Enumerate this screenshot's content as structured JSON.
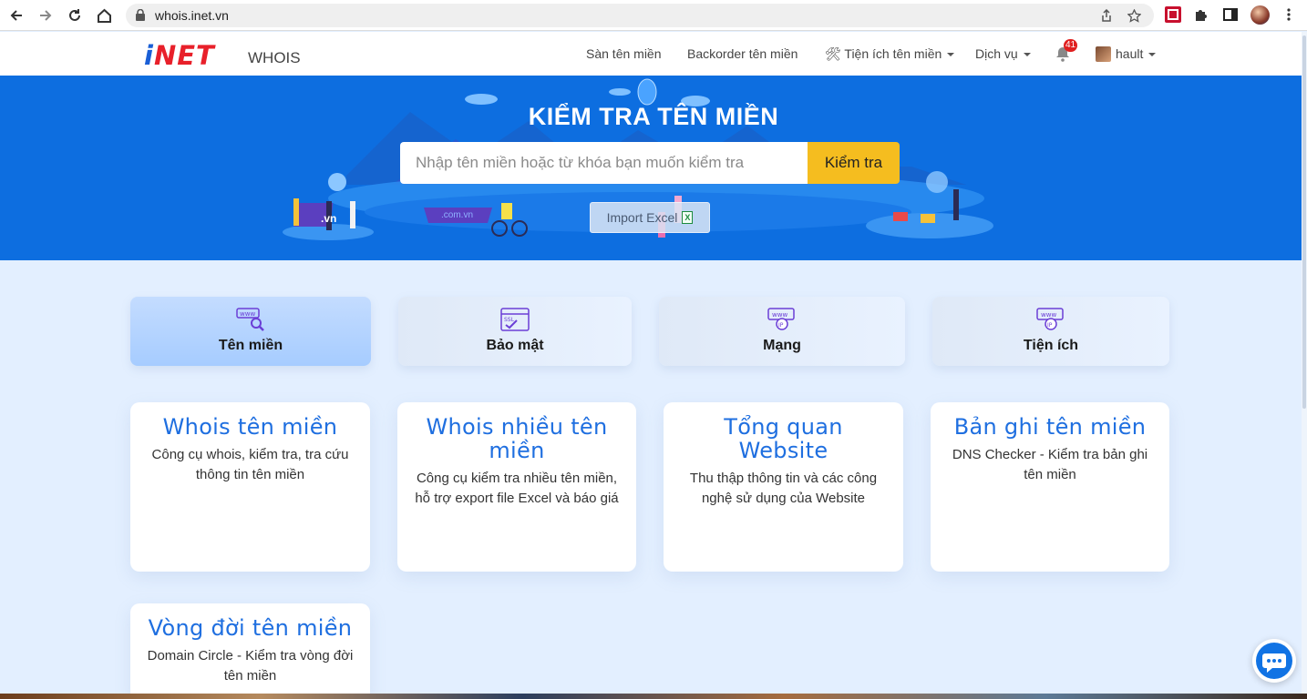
{
  "browser": {
    "url": "whois.inet.vn"
  },
  "header": {
    "logo_text": "iNET",
    "logo_i": "i",
    "logo_rest": "NET",
    "section_label": "WHOIS",
    "menu": [
      {
        "label": "Sàn tên miền"
      },
      {
        "label": "Backorder tên miền"
      },
      {
        "label": "🛠 Tiện ích tên miền"
      },
      {
        "label": "Dịch vụ"
      }
    ],
    "notifications_count": "41",
    "username": "hault"
  },
  "hero": {
    "title": "KIỂM TRA TÊN MIỀN",
    "search_placeholder": "Nhập tên miền hoặc từ khóa bạn muốn kiểm tra",
    "search_button": "Kiểm tra",
    "import_button": "Import Excel",
    "xls_glyph": "X",
    "badge_vn": ".vn",
    "badge_comvn": ".com.vn"
  },
  "categories": [
    {
      "label": "Tên miền",
      "icon": "www-search-icon",
      "active": true
    },
    {
      "label": "Bảo mật",
      "icon": "ssl-icon",
      "active": false
    },
    {
      "label": "Mạng",
      "icon": "www-ip-icon",
      "active": false
    },
    {
      "label": "Tiện ích",
      "icon": "www-ip-icon",
      "active": false
    }
  ],
  "tools": [
    {
      "title": "Whois tên miền",
      "desc": "Công cụ whois, kiểm tra, tra cứu thông tin tên miền"
    },
    {
      "title": "Whois nhiều tên miền",
      "desc": "Công cụ kiểm tra nhiều tên miền, hỗ trợ export file Excel và báo giá"
    },
    {
      "title": "Tổng quan Website",
      "desc": "Thu thập thông tin và các công nghệ sử dụng của Website"
    },
    {
      "title": "Bản ghi tên miền",
      "desc": "DNS Checker - Kiểm tra bản ghi tên miền"
    },
    {
      "title": "Vòng đời tên miền",
      "desc": "Domain Circle - Kiểm tra vòng đời tên miền"
    }
  ],
  "colors": {
    "hero_bg": "#0d6ee0",
    "accent_button": "#f5bd1f",
    "card_title": "#1f6fe0",
    "logo_red": "#e8202a",
    "logo_blue": "#1a5fd6"
  }
}
